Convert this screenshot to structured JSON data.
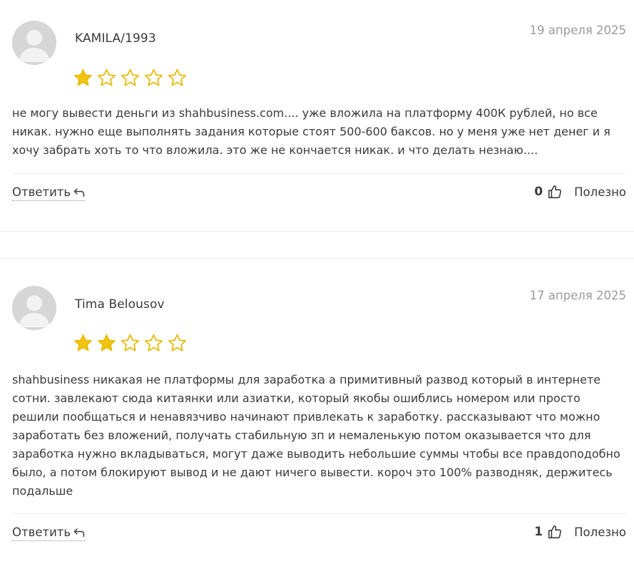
{
  "reviews": [
    {
      "author": "KAMILA/1993",
      "date": "19 апреля 2025",
      "rating": 1,
      "max_rating": 5,
      "text": "не могу вывести деньги из shahbusiness.com.... уже вложила на платформу 400К рублей, но все никак. нужно еще выполнять задания которые стоят 500-600 баксов. но у меня уже нет денег и я хочу забрать хоть то что вложила. это же не кончается никак. и что делать незнаю....",
      "reply_label": "Ответить",
      "helpful_count": "0",
      "helpful_label": "Полезно"
    },
    {
      "author": "Tima Belousov",
      "date": "17 апреля 2025",
      "rating": 2,
      "max_rating": 5,
      "text": "shahbusiness никакая не платформы для заработка а примитивный развод который в интернете сотни. завлекают сюда китаянки или азиатки, который якобы ошиблись номером или просто решили пообщаться и ненавязчиво начинают привлекать к заработку. рассказывают что можно заработать без вложений, получать стабильную зп и немаленькую потом оказывается что для заработка нужно вкладываться, могут даже выводить небольшие суммы чтобы все правдоподобно было, а потом блокируют вывод и не дают ничего вывести. короч это 100% разводняк, держитесь подальше",
      "reply_label": "Ответить",
      "helpful_count": "1",
      "helpful_label": "Полезно"
    }
  ],
  "colors": {
    "star_filled": "#f1c40f",
    "star_outline": "#e6b800",
    "date": "#9a9a9a",
    "text": "#3a3a3a"
  },
  "icons": {
    "avatar": "user-avatar-placeholder",
    "star": "star-icon",
    "reply": "reply-arrow-icon",
    "helpful": "thumbs-up-icon"
  }
}
